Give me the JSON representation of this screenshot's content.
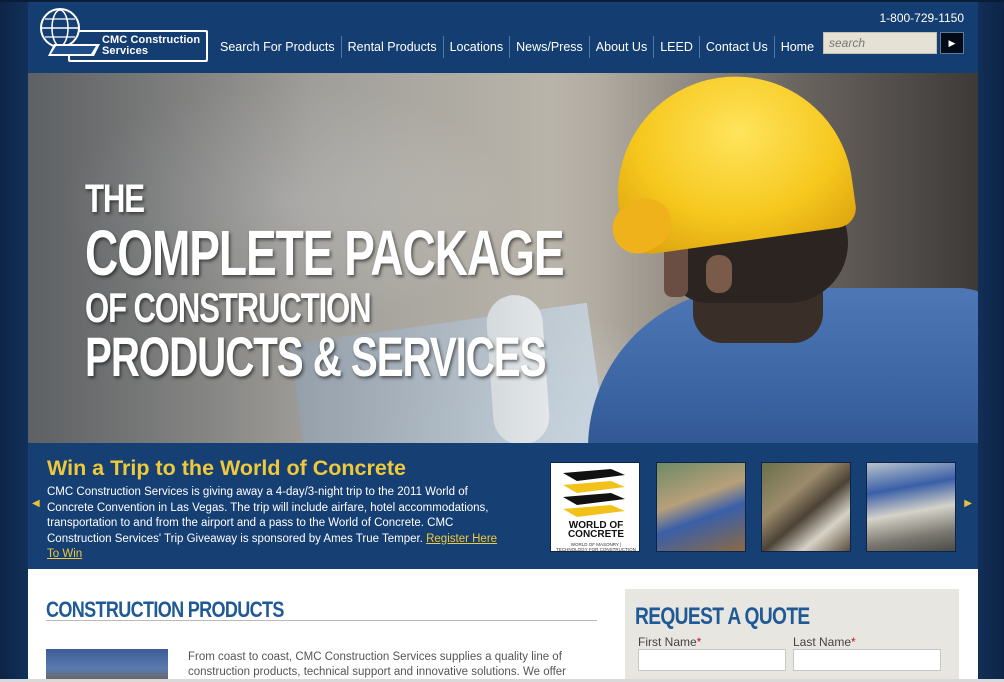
{
  "header": {
    "logo_text_line1": "CMC Construction",
    "logo_text_line2": "Services",
    "logo_mark": "CMC",
    "phone": "1-800-729-1150",
    "nav": [
      "Search For Products",
      "Rental Products",
      "Locations",
      "News/Press",
      "About Us",
      "LEED",
      "Contact Us",
      "Home"
    ],
    "search_placeholder": "search"
  },
  "hero": {
    "line1": "THE",
    "line2": "COMPLETE PACKAGE",
    "line3": "OF CONSTRUCTION",
    "line4": "PRODUCTS & SERVICES"
  },
  "promo": {
    "title": "Win a Trip to the World of Concrete",
    "body": "CMC Construction Services is giving away a 4-day/3-night trip to the 2011 World of Concrete Convention in Las Vegas. The trip will include airfare, hotel accommodations, transportation to and from the airport and a pass to the World of Concrete. CMC Construction Services' Trip Giveaway is sponsored by Ames True Temper.",
    "link": "Register Here To Win",
    "woc_line1": "WORLD OF",
    "woc_line2": "CONCRETE",
    "woc_sub": "WORLD OF MASONRY | TECHNOLOGY FOR CONSTRUCTION"
  },
  "products": {
    "title": "CONSTRUCTION PRODUCTS",
    "text": "From coast to coast, CMC Construction Services supplies a quality line of construction products, technical support and innovative solutions. We offer"
  },
  "quote": {
    "title": "REQUEST A QUOTE",
    "first_name": "First Name",
    "last_name": "Last Name",
    "required_mark": "*"
  },
  "colors": {
    "header_bg": "#143e72",
    "promo_bg": "#163f74",
    "accent_gold": "#f0c93a",
    "heading_blue": "#1f5a96"
  }
}
